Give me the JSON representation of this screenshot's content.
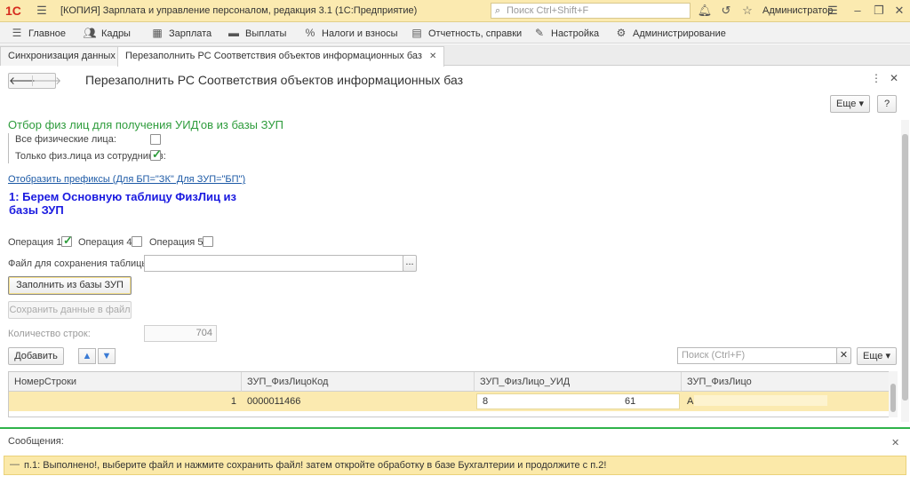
{
  "app": {
    "logo": "1С",
    "title": "[КОПИЯ] Зарплата и управление персоналом, редакция 3.1  (1С:Предприятие)",
    "search_placeholder": "Поиск Ctrl+Shift+F",
    "user": "Администратор"
  },
  "menu": [
    {
      "label": "Главное",
      "icon": "menu-lines-icon"
    },
    {
      "label": "Кадры",
      "icon": "people-icon"
    },
    {
      "label": "Зарплата",
      "icon": "calculator-icon"
    },
    {
      "label": "Выплаты",
      "icon": "wallet-icon"
    },
    {
      "label": "Налоги и взносы",
      "icon": "percent-icon"
    },
    {
      "label": "Отчетность, справки",
      "icon": "report-icon"
    },
    {
      "label": "Настройка",
      "icon": "wrench-icon"
    },
    {
      "label": "Администрирование",
      "icon": "gear-icon"
    }
  ],
  "tabs": [
    {
      "label": "Синхронизация данных"
    },
    {
      "label": "Перезаполнить РС Соответствия объектов информационных баз"
    }
  ],
  "form": {
    "title": "Перезаполнить РС Соответствия объектов информационных баз",
    "more_label": "Еще",
    "help_label": "?",
    "filter_title": "Отбор физ лиц для получения УИД'ов из базы ЗУП",
    "all_persons_label": "Все физические лица:",
    "only_employees_label": "Только физ.лица из сотрудников:",
    "prefix_link": "Отобразить префиксы (Для БП=\"ЗК\" Для ЗУП=\"БП\")",
    "step_heading": "1: Берем Основную таблицу ФизЛиц из базы ЗУП",
    "op1_label": "Операция 1:",
    "op4_label": "Операция 4:",
    "op5_label": "Операция 5:",
    "file_label": "Файл для сохранения таблицы 1:",
    "file_value": "",
    "browse_label": "...",
    "fill_button": "Заполнить из базы ЗУП",
    "save_button": "Сохранить данные в файл",
    "rows_count_label": "Количество строк:",
    "rows_count_value": "704",
    "add_button": "Добавить",
    "table_search_placeholder": "Поиск (Ctrl+F)",
    "table_more_label": "Еще"
  },
  "table": {
    "columns": [
      "НомерСтроки",
      "ЗУП_ФизЛицоКод",
      "ЗУП_ФизЛицо_УИД",
      "ЗУП_ФизЛицо"
    ],
    "rows": [
      {
        "num": "1",
        "code": "0000011466",
        "uid_start": "8",
        "uid_end": "61",
        "person": "А"
      }
    ]
  },
  "messages": {
    "title": "Сообщения:",
    "text": "п.1: Выполнено!, выберите файл и нажмите сохранить файл!  затем откройте обработку в базе Бухгалтерии и продолжите с п.2!"
  },
  "colors": {
    "accent_yellow": "#fbeab0",
    "green": "#2e9c3c",
    "link_blue": "#1d5aa6",
    "heading_blue": "#1a1ae0"
  }
}
